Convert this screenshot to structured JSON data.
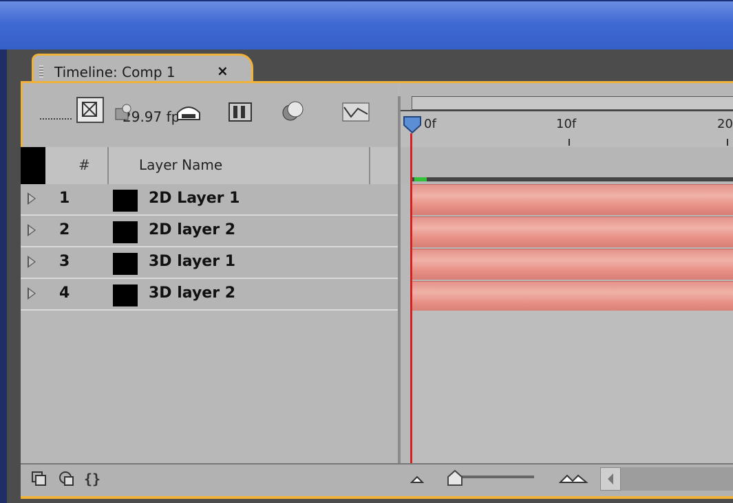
{
  "tab": {
    "title": "Timeline: Comp 1",
    "close": "×"
  },
  "toolbar": {
    "fps_text": "29.97 fp"
  },
  "ruler": {
    "ticks": [
      "0f",
      "10f",
      "20"
    ]
  },
  "columns": {
    "number": "#",
    "name": "Layer Name"
  },
  "layers": [
    {
      "num": "1",
      "name": "2D Layer 1"
    },
    {
      "num": "2",
      "name": "2D layer 2"
    },
    {
      "num": "3",
      "name": "3D layer 1"
    },
    {
      "num": "4",
      "name": "3D layer 2"
    }
  ],
  "colors": {
    "accent": "#f0b23a",
    "layer_bar": "#e89a90",
    "playhead": "#d42222",
    "work_area_marker": "#33c13b"
  },
  "icons": [
    "comp-icon",
    "draft-3d-icon",
    "shy-icon",
    "frame-blend-icon",
    "motion-blur-icon",
    "graph-editor-icon",
    "toggle-switches-icon",
    "toggle-modes-icon",
    "braces-icon",
    "zoom-out-icon",
    "zoom-in-icon"
  ]
}
